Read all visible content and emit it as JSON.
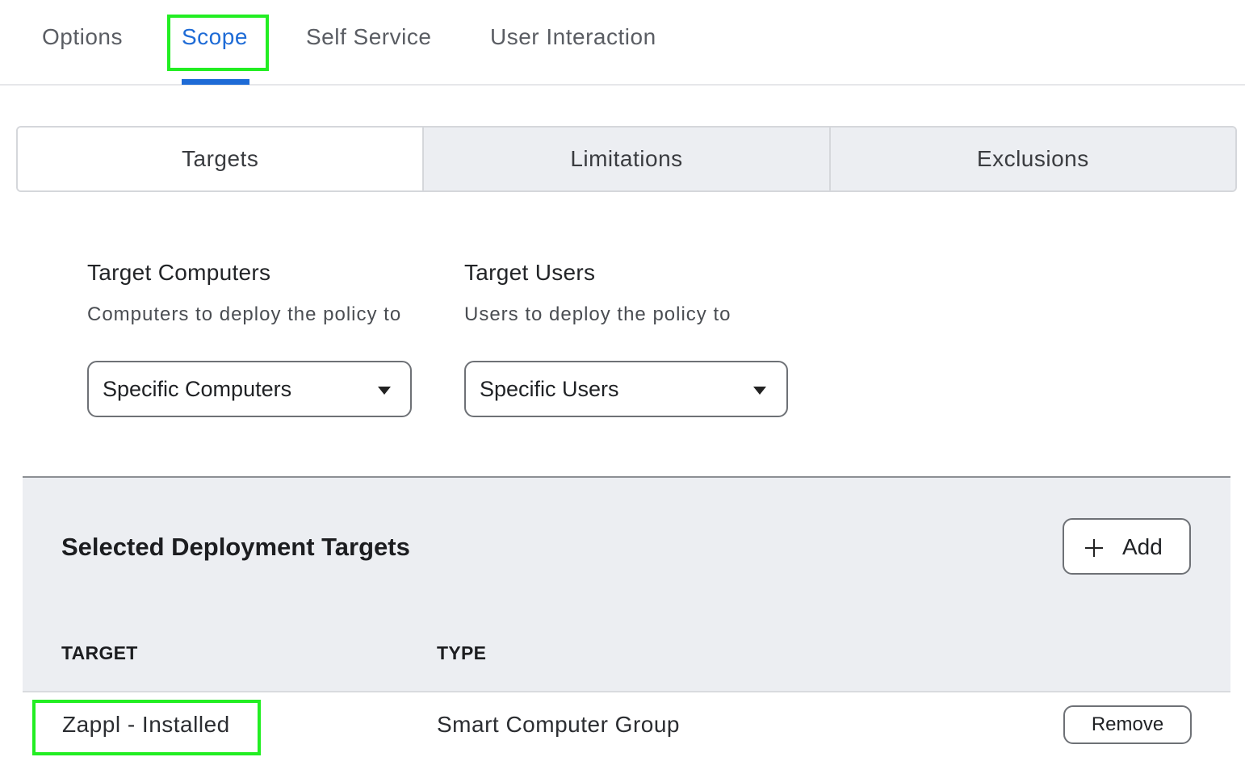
{
  "tabs": [
    {
      "label": "Options",
      "active": false
    },
    {
      "label": "Scope",
      "active": true
    },
    {
      "label": "Self Service",
      "active": false
    },
    {
      "label": "User Interaction",
      "active": false
    }
  ],
  "segments": [
    {
      "label": "Targets",
      "selected": true
    },
    {
      "label": "Limitations",
      "selected": false
    },
    {
      "label": "Exclusions",
      "selected": false
    }
  ],
  "target_computers": {
    "title": "Target Computers",
    "description": "Computers to deploy the policy to",
    "selected": "Specific Computers"
  },
  "target_users": {
    "title": "Target Users",
    "description": "Users to deploy the policy to",
    "selected": "Specific Users"
  },
  "deployment_targets": {
    "title": "Selected Deployment Targets",
    "add_label": "Add",
    "columns": [
      "TARGET",
      "TYPE"
    ],
    "rows": [
      {
        "target": "Zappl - Installed",
        "type": "Smart Computer Group",
        "action": "Remove"
      }
    ]
  },
  "colors": {
    "accent": "#1e6bd6",
    "highlight": "#22ee22",
    "panel_bg": "#eceef2"
  },
  "icons": [
    "plus-icon",
    "caret-down-icon"
  ]
}
